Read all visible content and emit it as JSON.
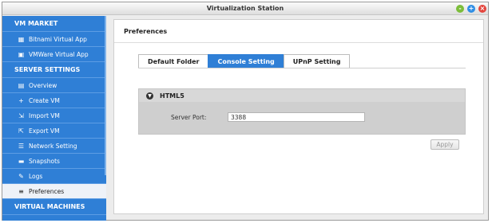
{
  "window": {
    "title": "Virtualization Station",
    "controls": {
      "minimize": "-",
      "maximize": "+",
      "close": "×"
    }
  },
  "sidebar": {
    "sections": [
      {
        "label": "VM MARKET",
        "items": [
          {
            "label": "Bitnami Virtual App",
            "icon": "bitnami-icon",
            "glyph": "▦"
          },
          {
            "label": "VMWare Virtual App",
            "icon": "vmware-icon",
            "glyph": "▣"
          }
        ]
      },
      {
        "label": "SERVER SETTINGS",
        "items": [
          {
            "label": "Overview",
            "icon": "overview-icon",
            "glyph": "▤"
          },
          {
            "label": "Create VM",
            "icon": "plus-icon",
            "glyph": "+"
          },
          {
            "label": "Import VM",
            "icon": "import-icon",
            "glyph": "⇲"
          },
          {
            "label": "Export VM",
            "icon": "export-icon",
            "glyph": "⇱"
          },
          {
            "label": "Network Setting",
            "icon": "network-icon",
            "glyph": "☰"
          },
          {
            "label": "Snapshots",
            "icon": "folder-icon",
            "glyph": "▬"
          },
          {
            "label": "Logs",
            "icon": "logs-icon",
            "glyph": "✎"
          },
          {
            "label": "Preferences",
            "icon": "preferences-icon",
            "glyph": "≡",
            "active": true
          }
        ]
      },
      {
        "label": "VIRTUAL MACHINES",
        "items": []
      }
    ]
  },
  "main": {
    "title": "Preferences",
    "tabs": [
      {
        "label": "Default Folder",
        "active": false
      },
      {
        "label": "Console Setting",
        "active": true
      },
      {
        "label": "UPnP Setting",
        "active": false
      }
    ],
    "section": {
      "title": "HTML5",
      "field_label": "Server Port:",
      "field_value": "3388"
    },
    "apply_label": "Apply"
  },
  "colors": {
    "accent": "#2f7fd6",
    "sidebar_bg": "#2f7fd6",
    "active_item_bg": "#eef2f8",
    "section_bg": "#cfcfcf"
  }
}
